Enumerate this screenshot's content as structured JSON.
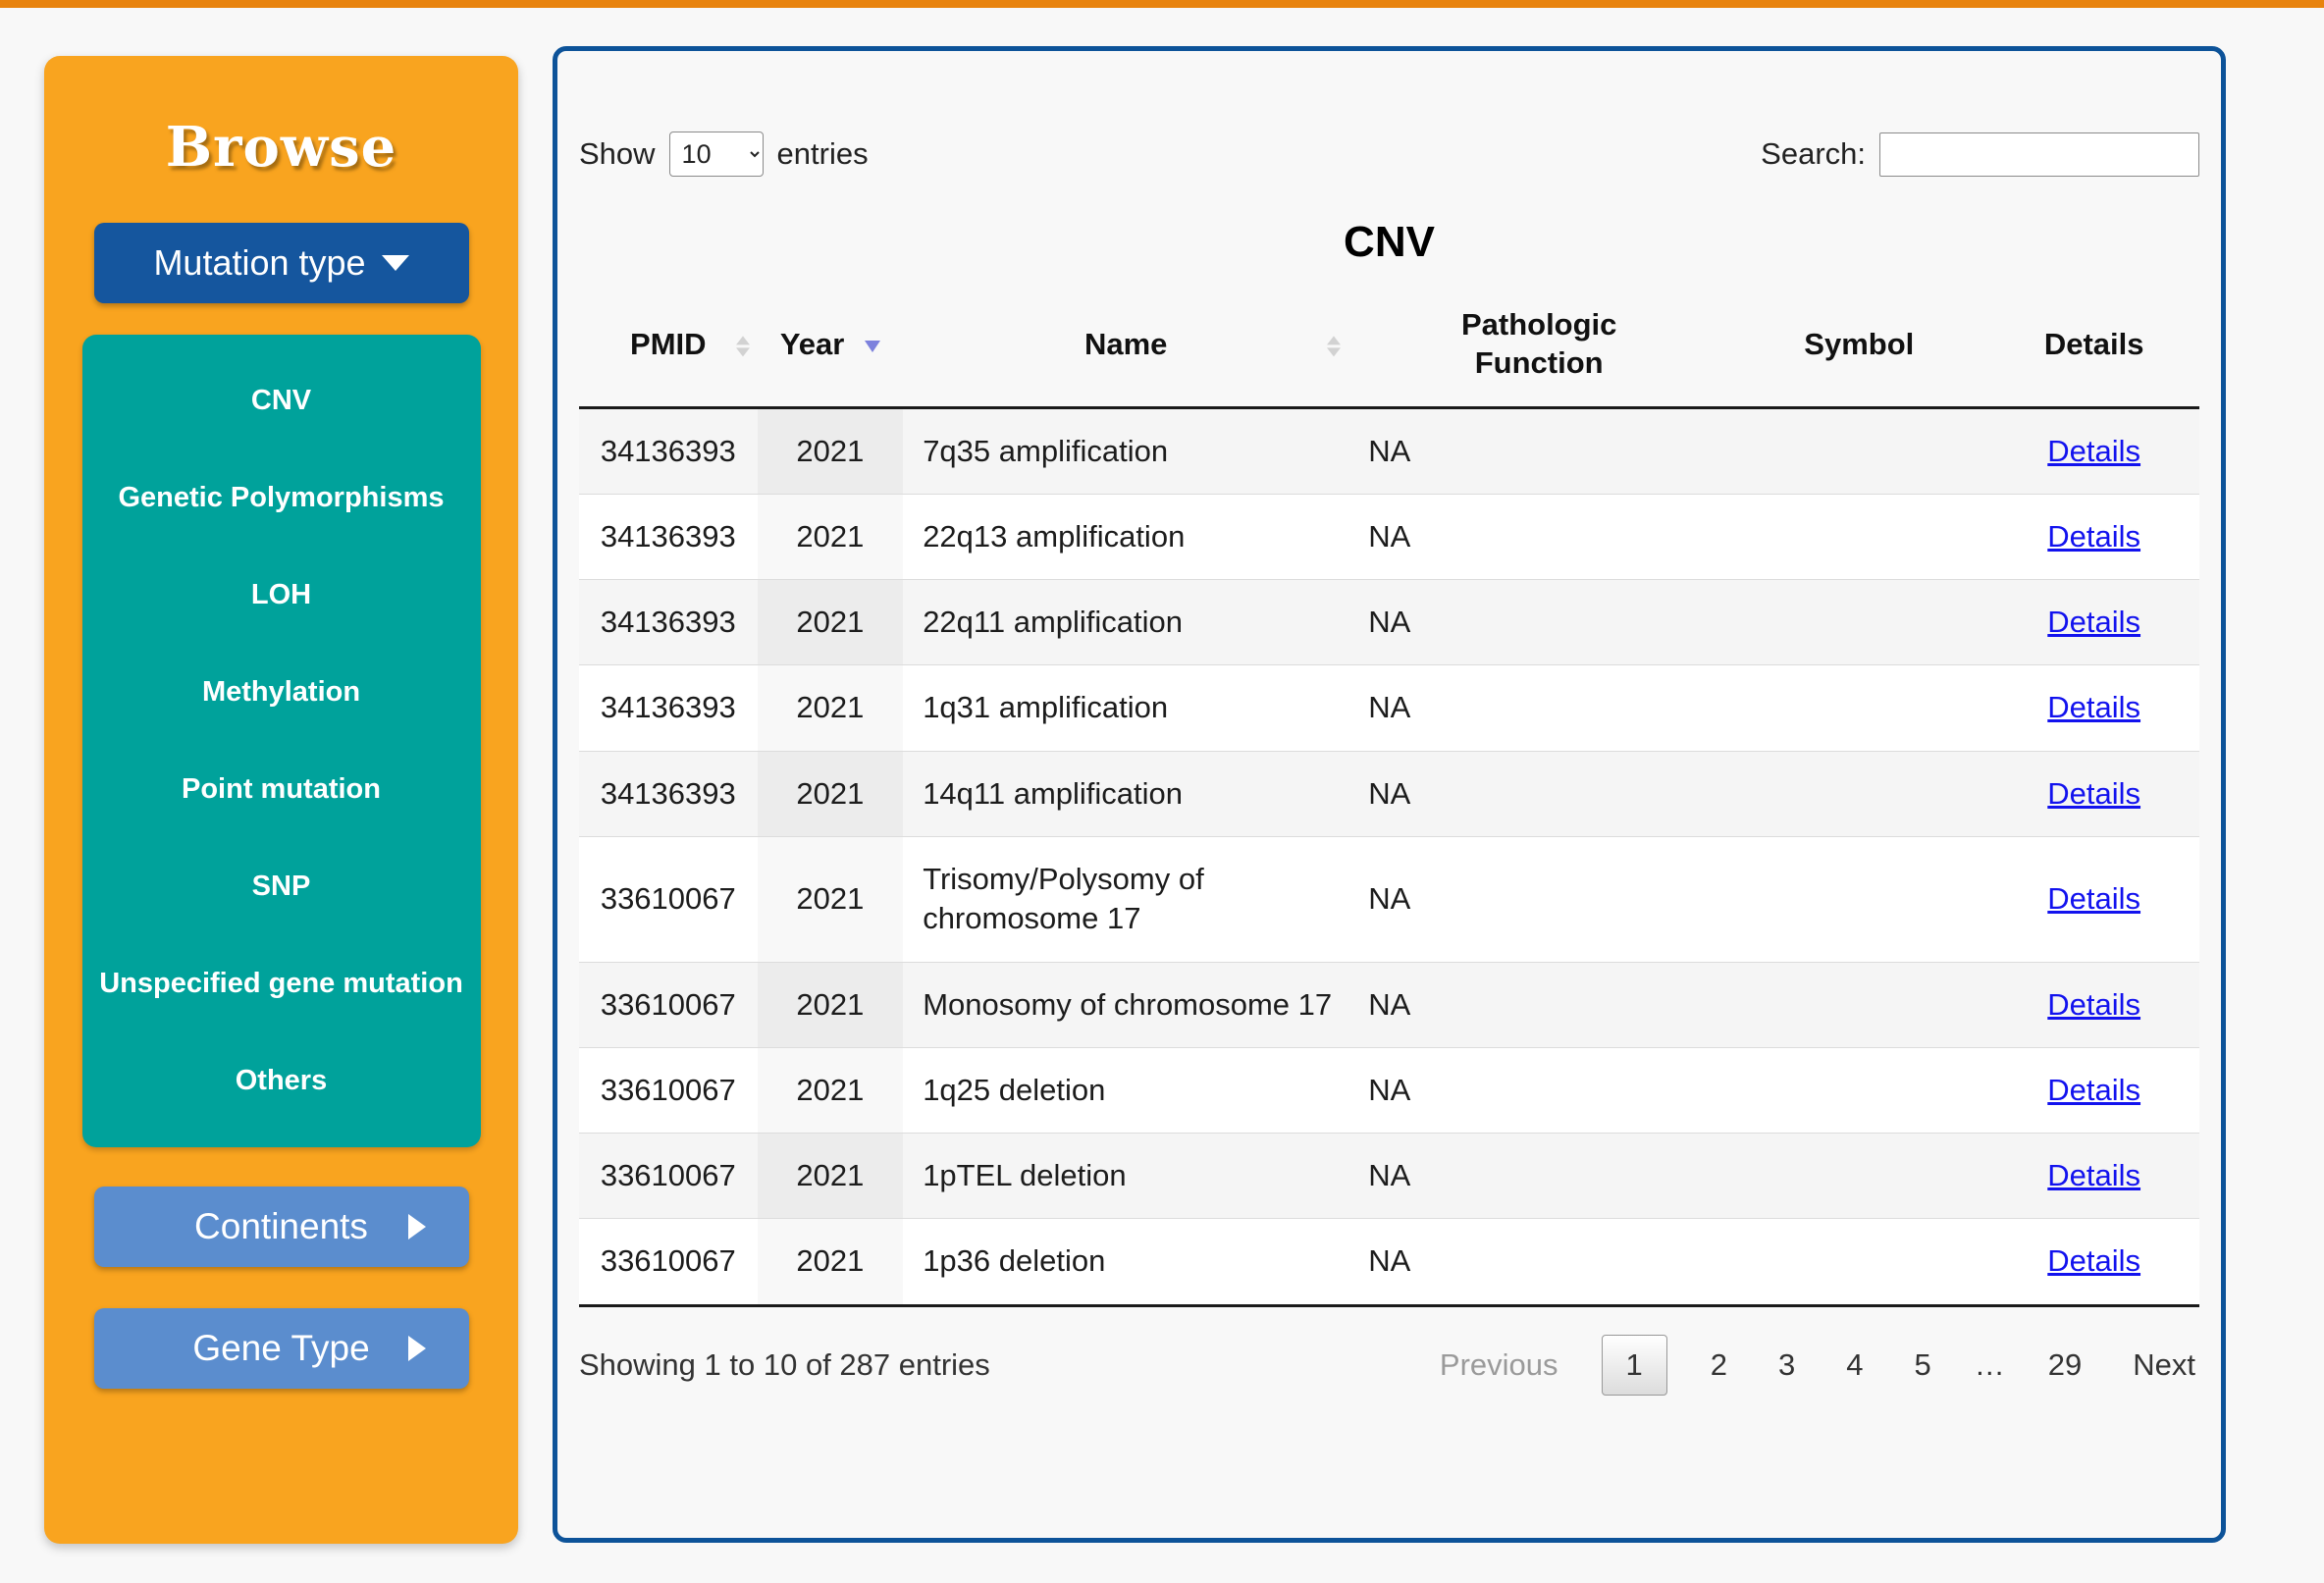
{
  "colors": {
    "top_bar": "#e8830e",
    "sidebar_background": "#f9a41f",
    "primary_button": "#15569e",
    "mutation_list_background": "#00a29b",
    "secondary_button": "#5b8dce",
    "panel_border": "#0d5399",
    "link_blue": "#1212ee",
    "sort_active_arrow": "#7d82dd"
  },
  "sidebar": {
    "title": "Browse",
    "mutation_type_button": {
      "label": "Mutation type"
    },
    "mutation_items": [
      "CNV",
      "Genetic Polymorphisms",
      "LOH",
      "Methylation",
      "Point mutation",
      "SNP",
      "Unspecified gene mutation",
      "Others"
    ],
    "continents_button": {
      "label": "Continents"
    },
    "gene_type_button": {
      "label": "Gene Type"
    }
  },
  "main": {
    "show_label": "Show",
    "entries_label": "entries",
    "page_length": "10",
    "search_label": "Search:",
    "search_value": "",
    "title": "CNV",
    "table": {
      "columns": [
        {
          "label": "PMID",
          "sort": "both"
        },
        {
          "label": "Year",
          "sort": "desc"
        },
        {
          "label": "Name",
          "sort": "both"
        },
        {
          "label": "Pathologic Function",
          "sort": "none"
        },
        {
          "label": "Symbol",
          "sort": "none"
        },
        {
          "label": "Details",
          "sort": "none"
        }
      ],
      "rows": [
        {
          "pmid": "34136393",
          "year": "2021",
          "name": "7q35 amplification",
          "pathologic_function": "NA",
          "symbol": "",
          "details": "Details"
        },
        {
          "pmid": "34136393",
          "year": "2021",
          "name": "22q13 amplification",
          "pathologic_function": "NA",
          "symbol": "",
          "details": "Details"
        },
        {
          "pmid": "34136393",
          "year": "2021",
          "name": "22q11 amplification",
          "pathologic_function": "NA",
          "symbol": "",
          "details": "Details"
        },
        {
          "pmid": "34136393",
          "year": "2021",
          "name": "1q31 amplification",
          "pathologic_function": "NA",
          "symbol": "",
          "details": "Details"
        },
        {
          "pmid": "34136393",
          "year": "2021",
          "name": "14q11 amplification",
          "pathologic_function": "NA",
          "symbol": "",
          "details": "Details"
        },
        {
          "pmid": "33610067",
          "year": "2021",
          "name": "Trisomy/Polysomy of chromosome 17",
          "pathologic_function": "NA",
          "symbol": "",
          "details": "Details"
        },
        {
          "pmid": "33610067",
          "year": "2021",
          "name": "Monosomy of chromosome 17",
          "pathologic_function": "NA",
          "symbol": "",
          "details": "Details"
        },
        {
          "pmid": "33610067",
          "year": "2021",
          "name": "1q25 deletion",
          "pathologic_function": "NA",
          "symbol": "",
          "details": "Details"
        },
        {
          "pmid": "33610067",
          "year": "2021",
          "name": "1pTEL deletion",
          "pathologic_function": "NA",
          "symbol": "",
          "details": "Details"
        },
        {
          "pmid": "33610067",
          "year": "2021",
          "name": "1p36 deletion",
          "pathologic_function": "NA",
          "symbol": "",
          "details": "Details"
        }
      ]
    },
    "footer": {
      "info": "Showing 1 to 10 of 287 entries",
      "pagination": [
        "Previous",
        "1",
        "2",
        "3",
        "4",
        "5",
        "…",
        "29",
        "Next"
      ],
      "current_page": "1"
    }
  }
}
